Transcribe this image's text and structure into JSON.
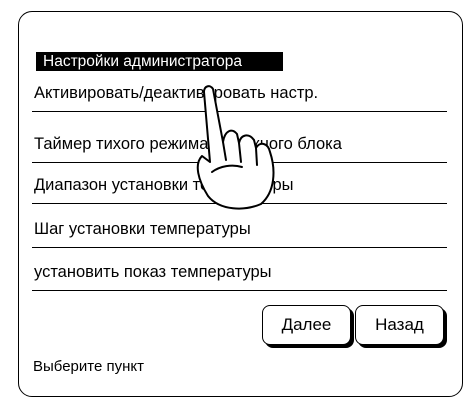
{
  "header": {
    "title": "Настройки администратора"
  },
  "menu": {
    "items": [
      {
        "label": "Активировать/деактивировать настр."
      },
      {
        "label": "Таймер тихого режима наружного блока"
      },
      {
        "label": "Диапазон установки температуры"
      },
      {
        "label": "Шаг установки температуры"
      },
      {
        "label": "установить показ температуры"
      }
    ]
  },
  "buttons": {
    "next_label": "Далее",
    "back_label": "Назад"
  },
  "status": {
    "text": "Выберите пункт"
  },
  "icons": {
    "pointer": "hand-pointer-icon"
  }
}
